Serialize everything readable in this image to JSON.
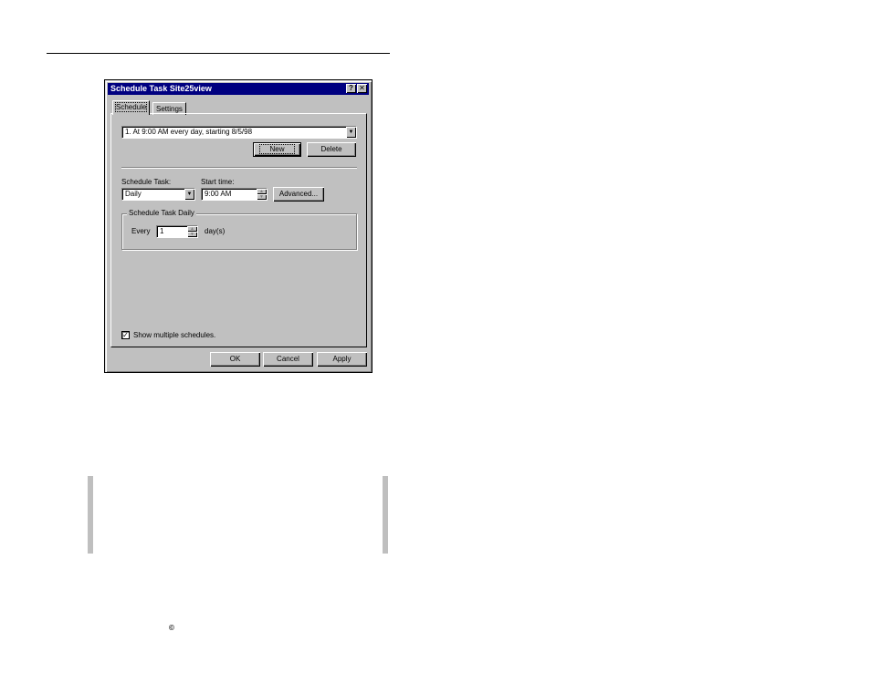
{
  "window": {
    "title": "Schedule Task Site25view",
    "help_glyph": "?",
    "close_glyph": "✕"
  },
  "tabs": [
    {
      "label": "Schedule"
    },
    {
      "label": "Settings"
    }
  ],
  "schedule_list": {
    "value": "1. At 9:00 AM every day, starting 8/5/98"
  },
  "buttons": {
    "new": "New",
    "delete": "Delete",
    "advanced": "Advanced...",
    "ok": "OK",
    "cancel": "Cancel",
    "apply": "Apply"
  },
  "schedule_task": {
    "label": "Schedule Task:",
    "value": "Daily"
  },
  "start_time": {
    "label": "Start time:",
    "value": "9:00 AM"
  },
  "daily_group": {
    "title": "Schedule Task Daily",
    "every_label": "Every",
    "every_value": "1",
    "unit_label": "day(s)"
  },
  "show_multiple": {
    "label": "Show multiple schedules.",
    "checked": "✓"
  },
  "footer": {
    "copyright_symbol": "©"
  },
  "colors": {
    "title_bar": "#000080",
    "face": "#c0c0c0"
  }
}
